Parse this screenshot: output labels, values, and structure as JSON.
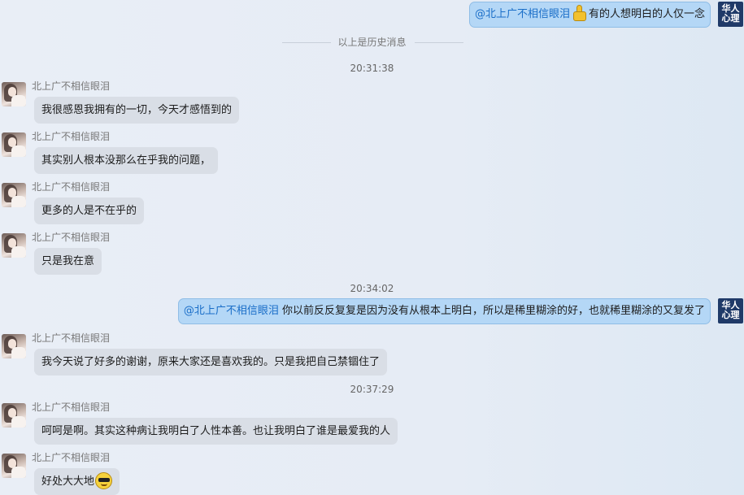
{
  "self_name": "@北上广不相信眼泪",
  "self_avatar_text": [
    "华人",
    "心理"
  ],
  "history_label": "以上是历史消息",
  "sender_name": "北上广不相信眼泪",
  "messages": {
    "m0": {
      "mention": "@北上广不相信眼泪",
      "text": "有的人想明白的人仅一念"
    },
    "t1": "20:31:38",
    "m1": "我很感恩我拥有的一切，今天才感悟到的",
    "m2": "其实别人根本没那么在乎我的问题，",
    "m3": "更多的人是不在乎的",
    "m4": "只是我在意",
    "t2": "20:34:02",
    "m5": {
      "mention": "@北上广不相信眼泪",
      "text": " 你以前反反复复是因为没有从根本上明白，所以是稀里糊涂的好，也就稀里糊涂的又复发了"
    },
    "m6": "我今天说了好多的谢谢，原来大家还是喜欢我的。只是我把自己禁锢住了",
    "t3": "20:37:29",
    "m7": "呵呵是啊。其实这种病让我明白了人性本善。也让我明白了谁是最爱我的人",
    "m8": "好处大大地"
  },
  "emoji": {
    "m0": "thumbs-up-icon",
    "m8": "cool-face-icon"
  },
  "colors": {
    "self_bubble": "#b4d7f6",
    "other_bubble": "#d9dee6",
    "mention": "#1a6ec8",
    "self_avatar": "#1f3a68"
  }
}
